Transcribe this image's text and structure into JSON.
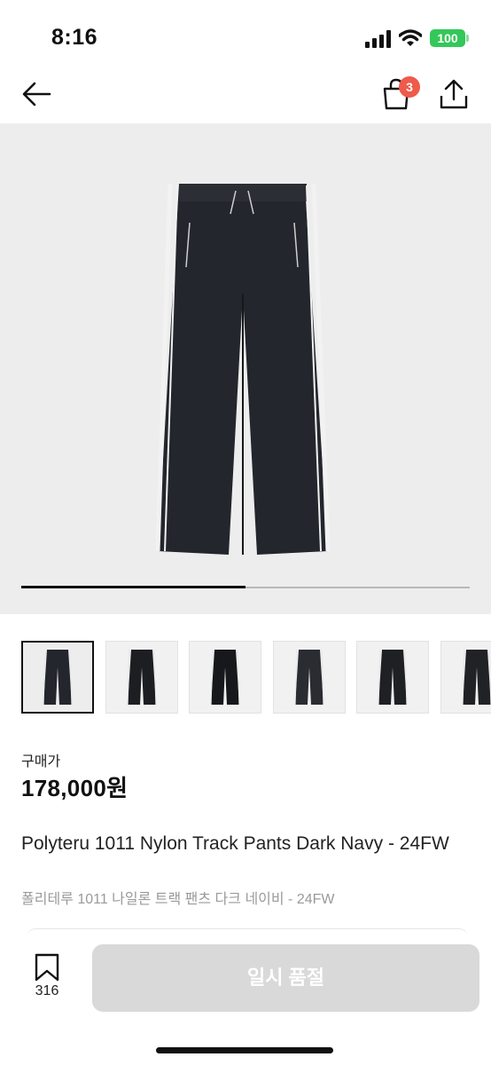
{
  "status": {
    "time": "8:16",
    "battery": "100"
  },
  "nav": {
    "cart_count": "3"
  },
  "gallery": {
    "progress": 0.5,
    "thumb_count": 6,
    "selected_index": 0
  },
  "product": {
    "price_label": "구매가",
    "price": "178,000원",
    "title_en": "Polyteru 1011 Nylon Track Pants Dark Navy - 24FW",
    "title_ko": "폴리테루 1011 나일론 트랙 팬츠 다크 네이비 - 24FW"
  },
  "bottom": {
    "bookmark_count": "316",
    "soldout_label": "일시 품절"
  },
  "colors": {
    "badge": "#ef5a4a",
    "battery": "#34c759",
    "button_disabled": "#d9d9d9",
    "image_bg": "#ededed"
  }
}
